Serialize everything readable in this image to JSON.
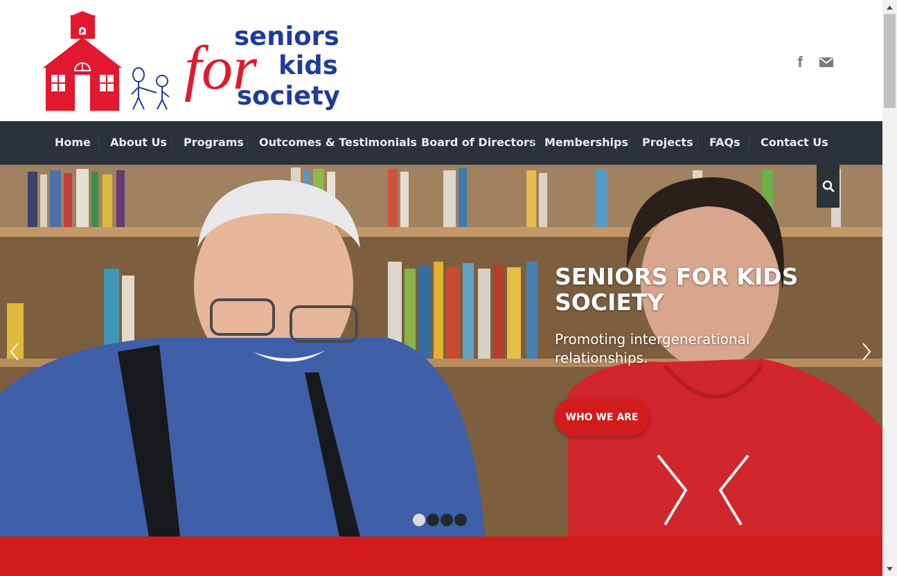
{
  "logo": {
    "line1": "seniors",
    "for": "for",
    "line2": "kids",
    "line3": "society"
  },
  "social": {
    "facebook_glyph": "f",
    "facebook_icon": "facebook-icon",
    "mail_icon": "mail-icon"
  },
  "nav": {
    "items": [
      {
        "label": "Home"
      },
      {
        "label": "About Us"
      },
      {
        "label": "Programs"
      },
      {
        "label": "Outcomes & Testimonials"
      },
      {
        "label": "Board of Directors"
      },
      {
        "label": "Memberships"
      },
      {
        "label": "Projects"
      },
      {
        "label": "FAQs"
      },
      {
        "label": "Contact Us"
      }
    ],
    "search_icon": "search-icon"
  },
  "hero": {
    "title": "SENIORS FOR KIDS SOCIETY",
    "subtitle": "Promoting intergenerational relationships.",
    "button_label": "WHO WE ARE",
    "slide_count": 4,
    "active_slide": 1
  },
  "colors": {
    "brand_red": "#d21c1c",
    "logo_red": "#e3172d",
    "logo_blue": "#1f3c9a",
    "nav_bg": "#2b323a"
  }
}
